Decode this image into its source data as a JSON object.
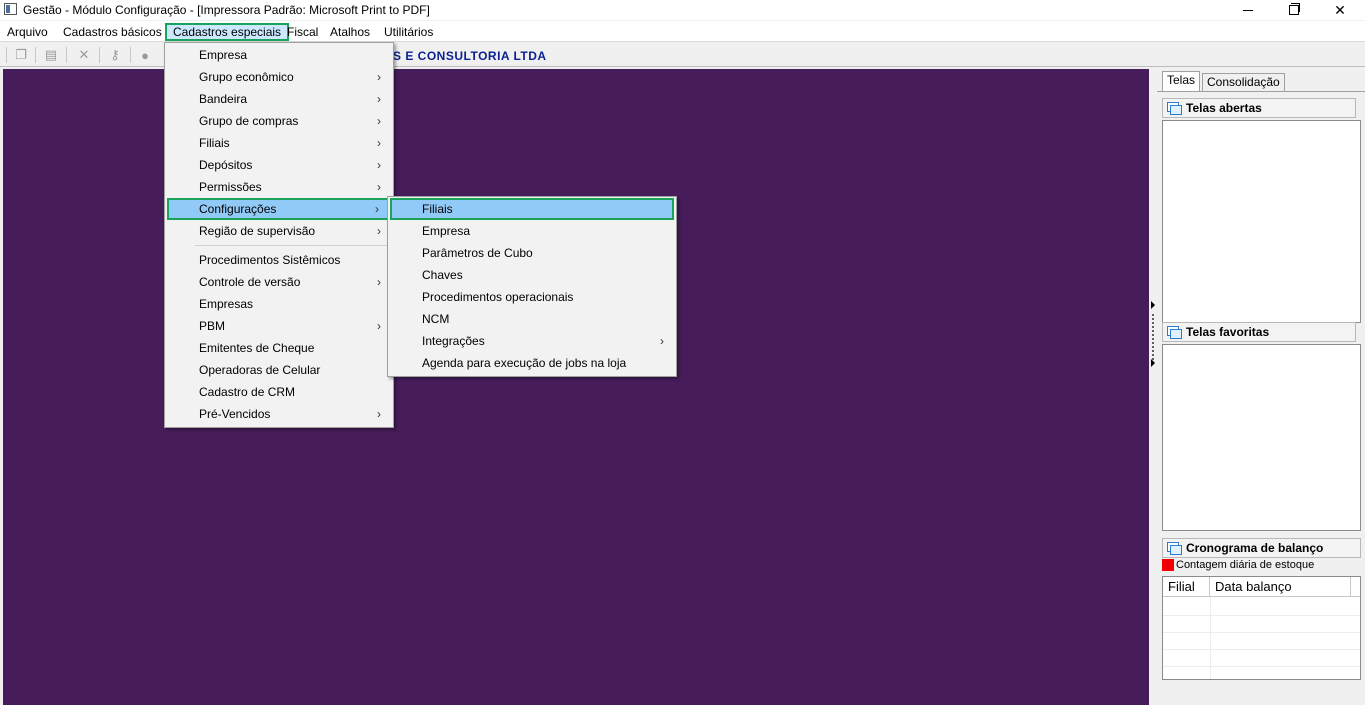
{
  "window": {
    "title": "Gestão  - Módulo Configuração - [Impressora Padrão: Microsoft Print to PDF]",
    "controls": {
      "minimize": "",
      "maximize": "",
      "close": "✕"
    }
  },
  "menubar": {
    "items": [
      "Arquivo",
      "Cadastros básicos",
      "Cadastros especiais",
      "Fiscal",
      "Atalhos",
      "Utilitários"
    ],
    "active": "Cadastros especiais"
  },
  "toolbar": {
    "company_banner": "S E CONSULTORIA LTDA",
    "buttons": [
      "copy-icon",
      "paste-icon",
      "delete-icon",
      "key-icon",
      "record-icon"
    ]
  },
  "cadastros_especiais_menu": {
    "items": [
      {
        "label": "Empresa",
        "submenu": false
      },
      {
        "label": "Grupo econômico",
        "submenu": true
      },
      {
        "label": "Bandeira",
        "submenu": true
      },
      {
        "label": "Grupo de compras",
        "submenu": true
      },
      {
        "label": "Filiais",
        "submenu": true
      },
      {
        "label": "Depósitos",
        "submenu": true
      },
      {
        "label": "Permissões",
        "submenu": true
      },
      {
        "label": "Configurações",
        "submenu": true,
        "active": true
      },
      {
        "label": "Região de supervisão",
        "submenu": true
      },
      {
        "label": "Procedimentos Sistêmicos",
        "submenu": false
      },
      {
        "label": "Controle de versão",
        "submenu": true
      },
      {
        "label": "Empresas",
        "submenu": false
      },
      {
        "label": "PBM",
        "submenu": true
      },
      {
        "label": "Emitentes de Cheque",
        "submenu": false
      },
      {
        "label": "Operadoras de Celular",
        "submenu": false
      },
      {
        "label": "Cadastro de CRM",
        "submenu": false
      },
      {
        "label": "Pré-Vencidos",
        "submenu": true
      }
    ],
    "arrow": "›"
  },
  "configuracoes_submenu": {
    "items": [
      {
        "label": "Filiais",
        "submenu": false,
        "active": true
      },
      {
        "label": "Empresa",
        "submenu": false
      },
      {
        "label": "Parâmetros de Cubo",
        "submenu": false
      },
      {
        "label": "Chaves",
        "submenu": false
      },
      {
        "label": "Procedimentos operacionais",
        "submenu": false
      },
      {
        "label": "NCM",
        "submenu": false
      },
      {
        "label": "Integrações",
        "submenu": true
      },
      {
        "label": "Agenda para execução de jobs na loja",
        "submenu": false
      }
    ]
  },
  "right_panel": {
    "tabs": [
      "Telas",
      "Consolidação"
    ],
    "active_tab": "Telas",
    "telas_abertas": {
      "title": "Telas abertas"
    },
    "telas_favoritas": {
      "title": "Telas favoritas"
    },
    "cronograma": {
      "title": "Cronograma de balanço",
      "legend": "Contagem diária de estoque",
      "legend_color": "#f00000",
      "columns": [
        "Filial",
        "Data balanço"
      ]
    }
  },
  "colors": {
    "workspace_bg": "#461c5b",
    "highlight_border": "#19a35b",
    "highlight_bg": "#91c9f7",
    "banner_text": "#0a1f8f"
  }
}
